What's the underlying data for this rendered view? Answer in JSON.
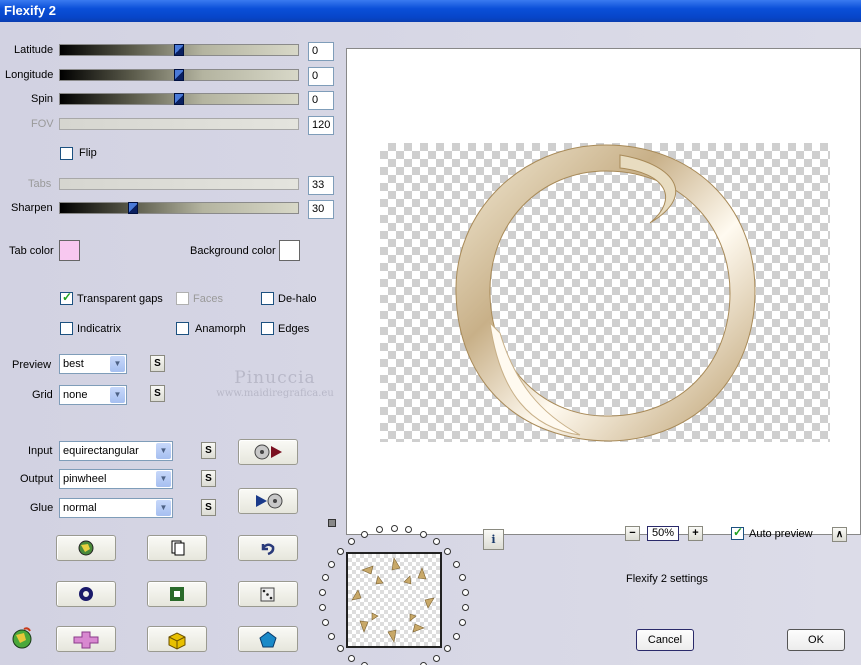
{
  "window": {
    "title": "Flexify 2"
  },
  "sliders": {
    "latitude": {
      "label": "Latitude",
      "value": "0"
    },
    "longitude": {
      "label": "Longitude",
      "value": "0"
    },
    "spin": {
      "label": "Spin",
      "value": "0"
    },
    "fov": {
      "label": "FOV",
      "value": "120"
    },
    "tabs": {
      "label": "Tabs",
      "value": "33"
    },
    "sharpen": {
      "label": "Sharpen",
      "value": "30"
    }
  },
  "flip": {
    "label": "Flip",
    "checked": false
  },
  "colors": {
    "tab_color_label": "Tab color",
    "tab_color": "#f8c8f0",
    "background_color_label": "Background color",
    "background_color": "#ffffff"
  },
  "options": {
    "transparent_gaps": "Transparent gaps",
    "faces": "Faces",
    "de_halo": "De-halo",
    "indicatrix": "Indicatrix",
    "anamorph": "Anamorph",
    "edges": "Edges"
  },
  "preview": {
    "label": "Preview",
    "value": "best"
  },
  "grid": {
    "label": "Grid",
    "value": "none"
  },
  "input": {
    "label": "Input",
    "value": "equirectangular"
  },
  "output": {
    "label": "Output",
    "value": "pinwheel"
  },
  "glue": {
    "label": "Glue",
    "value": "normal"
  },
  "watermark": {
    "name": "Pinuccia",
    "site": "www.maidiregrafica.eu"
  },
  "zoom": {
    "minus": "−",
    "value": "50%",
    "plus": "+"
  },
  "auto_preview": {
    "label": "Auto preview",
    "checked": true
  },
  "settings_label": "Flexify 2 settings",
  "s_label": "S",
  "up_label": "∧",
  "info_label": "i",
  "buttons": {
    "cancel": "Cancel",
    "ok": "OK"
  }
}
